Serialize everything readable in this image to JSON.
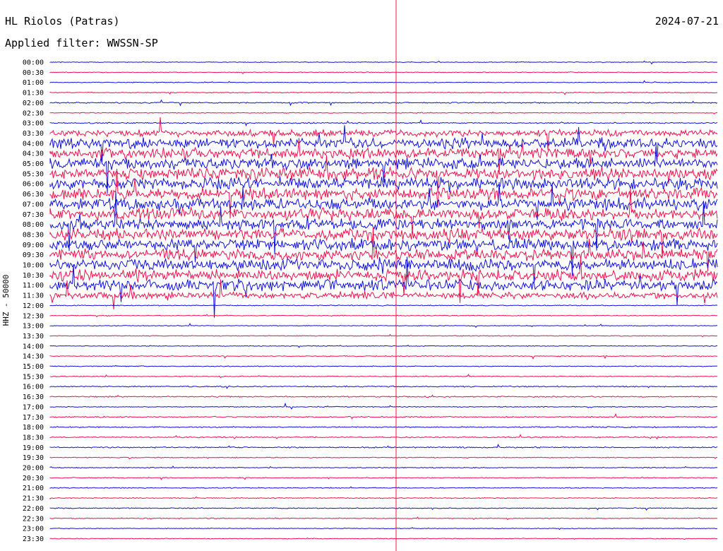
{
  "header": {
    "station": "HL Riolos (Patras)",
    "filter": "Applied filter: WWSSN-SP",
    "date": "2024-07-21"
  },
  "colors": {
    "blue": "#1010e0",
    "red": "#f0104a"
  },
  "chart_data": {
    "type": "line",
    "title": "HL Riolos (Patras)",
    "subtitle": "Applied filter: WWSSN-SP",
    "date": "2024-07-21",
    "ylabel": "HHZ - 50000",
    "series_colors": [
      "blue",
      "red"
    ],
    "y_tick_labels": [
      "00:00",
      "00:30",
      "01:00",
      "01:30",
      "02:00",
      "02:30",
      "03:00",
      "03:30",
      "04:00",
      "04:30",
      "05:00",
      "05:30",
      "06:00",
      "06:30",
      "07:00",
      "07:30",
      "08:00",
      "08:30",
      "09:00",
      "09:30",
      "10:00",
      "10:30",
      "11:00",
      "11:30",
      "12:00",
      "12:30",
      "13:00",
      "13:30",
      "14:00",
      "14:30",
      "15:00",
      "15:30",
      "16:00",
      "16:30",
      "17:00",
      "17:30",
      "18:00",
      "18:30",
      "19:00",
      "19:30",
      "20:00",
      "20:30",
      "21:00",
      "21:30",
      "22:00",
      "22:30",
      "23:00",
      "23:30"
    ],
    "trace_activity": [
      0.05,
      0.05,
      0.05,
      0.06,
      0.08,
      0.06,
      0.08,
      0.45,
      0.7,
      0.7,
      0.75,
      0.8,
      0.8,
      0.8,
      0.8,
      0.8,
      0.75,
      0.75,
      0.75,
      0.75,
      0.75,
      0.75,
      0.75,
      0.45,
      0.06,
      0.05,
      0.05,
      0.05,
      0.05,
      0.06,
      0.06,
      0.06,
      0.08,
      0.08,
      0.06,
      0.08,
      0.08,
      0.08,
      0.08,
      0.06,
      0.06,
      0.06,
      0.06,
      0.06,
      0.06,
      0.06,
      0.05,
      0.05
    ]
  }
}
